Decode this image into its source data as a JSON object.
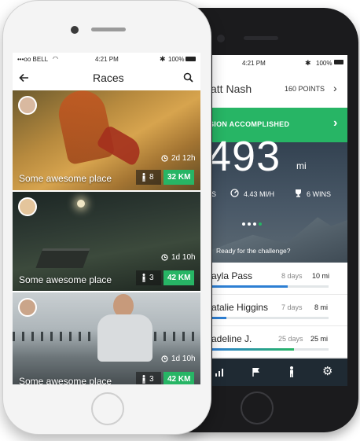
{
  "colors": {
    "accent_green": "#27b565",
    "dark_panel": "#1f2a33"
  },
  "front_phone": {
    "status_bar": {
      "carrier": "•••oo BELL",
      "time": "4:21 PM",
      "battery": "100%"
    },
    "nav": {
      "title": "Races",
      "back_icon": "arrow-left-icon",
      "search_icon": "search-icon"
    },
    "races": [
      {
        "name": "Some awesome place",
        "time_left": "2d 12h",
        "runners": "8",
        "distance": "32 KM"
      },
      {
        "name": "Some awesome place",
        "time_left": "1d 10h",
        "runners": "3",
        "distance": "42 KM"
      },
      {
        "name": "Some awesome place",
        "time_left": "1d 10h",
        "runners": "3",
        "distance": "42 KM"
      }
    ]
  },
  "back_phone": {
    "status_bar": {
      "time": "4:21 PM",
      "battery": "100%"
    },
    "header": {
      "name": "att Nash",
      "points": "160 POINTS"
    },
    "banner": {
      "text": "SION ACCOMPLISHED"
    },
    "hero": {
      "big_number": "493",
      "unit": "mi",
      "stats": [
        {
          "icon": "speedometer-icon",
          "text": "4.43 MI/H"
        },
        {
          "icon": "trophy-icon",
          "text": "6 WINS"
        }
      ],
      "partial_stat": "S",
      "challenge": "Ready for the challenge?"
    },
    "leaderboard": [
      {
        "name": "ayla Pass",
        "days": "8 days",
        "distance": "10 mi",
        "progress": 0.65
      },
      {
        "name": "atalie Higgins",
        "days": "7 days",
        "distance": "8 mi",
        "progress": 0.12
      },
      {
        "name": "adeline J.",
        "days": "25 days",
        "distance": "25 mi",
        "progress": 0.7
      }
    ],
    "tabbar": [
      "bar-chart-icon",
      "flag-icon",
      "runner-icon",
      "gear-icon"
    ]
  }
}
